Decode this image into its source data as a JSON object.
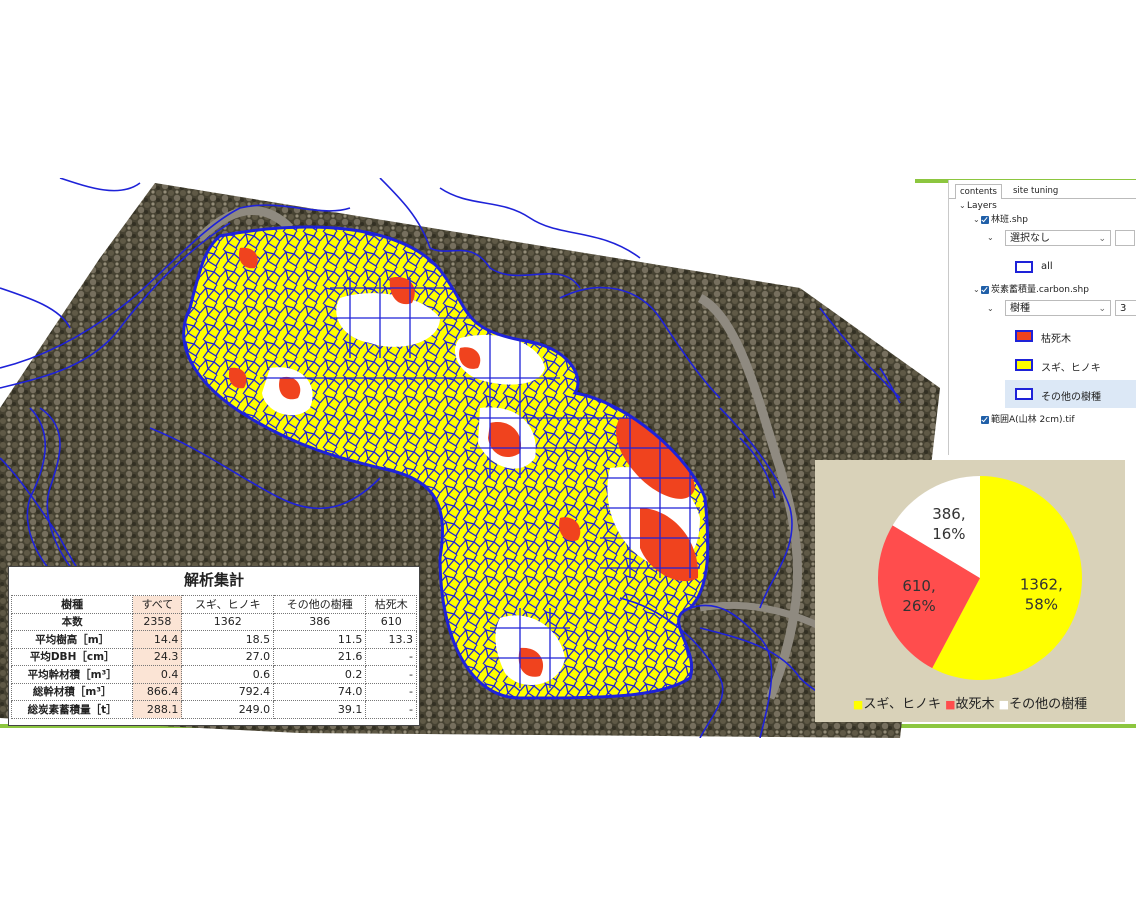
{
  "layers_panel": {
    "tabs": [
      "contents",
      "site tuning"
    ],
    "root_label": "Layers",
    "layer1": {
      "name": "林班.shp",
      "select_value": "選択なし",
      "legend": [
        {
          "label": "all",
          "fill": "#ffffff",
          "stroke": "#1e22d8"
        }
      ]
    },
    "layer2": {
      "name": "炭素蓄積量.carbon.shp",
      "select_value": "樹種",
      "class_count": "3",
      "legend": [
        {
          "label": "枯死木",
          "fill": "#f0431e",
          "stroke": "#1e22d8"
        },
        {
          "label": "スギ、ヒノキ",
          "fill": "#ffff00",
          "stroke": "#1e22d8"
        },
        {
          "label": "その他の樹種",
          "fill": "#ffffff",
          "stroke": "#1e22d8"
        }
      ]
    },
    "layer3": {
      "name": "範囲A(山林 2cm).tif"
    }
  },
  "stats": {
    "title": "解析集計",
    "headers": [
      "樹種",
      "すべて",
      "スギ、ヒノキ",
      "その他の樹種",
      "枯死木"
    ],
    "rows": [
      [
        "本数",
        "2358",
        "1362",
        "386",
        "610"
      ],
      [
        "平均樹高［m］",
        "14.4",
        "18.5",
        "11.5",
        "13.3"
      ],
      [
        "平均DBH［cm］",
        "24.3",
        "27.0",
        "21.6",
        "-"
      ],
      [
        "平均幹材積［m³］",
        "0.4",
        "0.6",
        "0.2",
        "-"
      ],
      [
        "総幹材積［m³］",
        "866.4",
        "792.4",
        "74.0",
        "-"
      ],
      [
        "総炭素蓄積量［t］",
        "288.1",
        "249.0",
        "39.1",
        "-"
      ]
    ]
  },
  "chart_data": {
    "type": "pie",
    "slices": [
      {
        "name": "スギ、ヒノキ",
        "value": 1362,
        "percent": 58,
        "color": "#ffff00",
        "label": [
          "1362,",
          "58%"
        ]
      },
      {
        "name": "故死木",
        "value": 610,
        "percent": 26,
        "color": "#ff4d4d",
        "label": [
          "610,",
          "26%"
        ]
      },
      {
        "name": "その他の樹種",
        "value": 386,
        "percent": 16,
        "color": "#ffffff",
        "label": [
          "386,",
          "16%"
        ]
      }
    ],
    "legend_placement": "bottom",
    "legend": [
      "スギ、ヒノキ",
      "故死木",
      "その他の樹種"
    ]
  },
  "colors": {
    "boundary": "#1e22d8",
    "sugi_hinoki": "#ffff00",
    "dead": "#f0431e",
    "other": "#ffffff",
    "forest_dark": "#3c3a2c",
    "accent_green": "#8cc63f",
    "pie_bg": "#d9d2b9"
  }
}
